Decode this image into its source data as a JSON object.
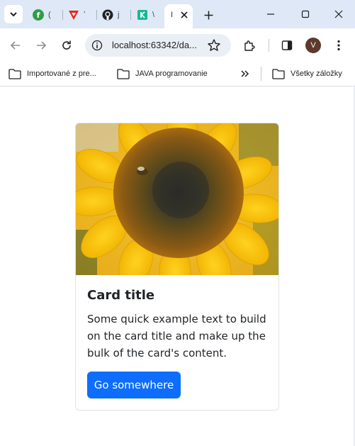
{
  "browser": {
    "tabs": [
      {
        "title": "(",
        "icon": "green-circle-icon",
        "color": "#2e9e44"
      },
      {
        "title": "ʼ",
        "icon": "red-v-icon",
        "color": "#e2231a"
      },
      {
        "title": "j",
        "icon": "github-icon",
        "color": "#1f2328"
      },
      {
        "title": "\\",
        "icon": "teal-k-icon",
        "color": "#17b890"
      }
    ],
    "active_tab": {
      "title": "I"
    },
    "address": "localhost:63342/da...",
    "profile_initial": "V",
    "bookmarks": [
      {
        "label": "Importované z pre..."
      },
      {
        "label": "JAVA programovanie"
      }
    ],
    "all_bookmarks_label": "Všetky záložky"
  },
  "card": {
    "image": "sunflower-image",
    "title": "Card title",
    "text": "Some quick example text to build on the card title and make up the bulk of the card's content.",
    "button_label": "Go somewhere",
    "button_color": "#0d6efd"
  }
}
